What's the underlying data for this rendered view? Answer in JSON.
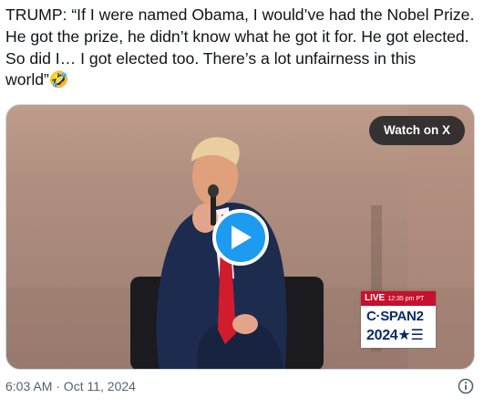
{
  "tweet": {
    "text": "TRUMP: “If I were named Obama, I would’ve had the Nobel Prize. He got the prize, he didn’t know what he got it for. He got elected. So did I… I got elected too. There’s a lot unfairness in this world”🤣",
    "timestamp": "6:03 AM · Oct 11, 2024"
  },
  "media": {
    "watch_label": "Watch on X",
    "play_icon": "play-icon",
    "overlay": {
      "live_label": "LIVE",
      "live_time": "12:35 pm PT",
      "network": "C·SPAN2",
      "year": "2024★☰"
    }
  },
  "colors": {
    "accent": "#1d9bf0",
    "live_red": "#c8102e",
    "cspan_blue": "#0a2a6b",
    "muted_text": "#536471"
  },
  "icons": {
    "info": "info-icon"
  }
}
